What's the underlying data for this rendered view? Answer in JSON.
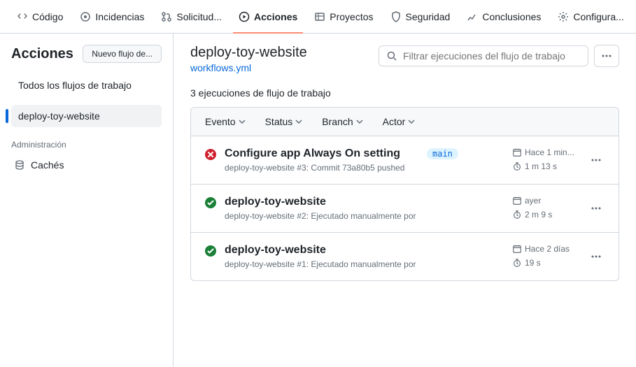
{
  "nav": {
    "code": "Código",
    "issues": "Incidencias",
    "pulls": "Solicitud...",
    "actions": "Acciones",
    "projects": "Proyectos",
    "security": "Seguridad",
    "insights": "Conclusiones",
    "settings": "Configura..."
  },
  "sidebar": {
    "title": "Acciones",
    "new_workflow_btn": "Nuevo flujo de...",
    "all_workflows": "Todos los flujos de trabajo",
    "selected_wf": "deploy-toy-website",
    "admin_label": "Administración",
    "caches": "Cachés"
  },
  "page": {
    "title": "deploy-toy-website",
    "file": "workflows.yml",
    "search_placeholder": "Filtrar ejecuciones del flujo de trabajo",
    "runs_count": "3 ejecuciones de flujo de trabajo"
  },
  "filters": {
    "event": "Evento",
    "status": "Status",
    "branch": "Branch",
    "actor": "Actor"
  },
  "runs": [
    {
      "status": "fail",
      "title": "Configure app Always On setting",
      "sub": "deploy-toy-website #3: Commit 73a80b5 pushed",
      "branch": "main",
      "time": "Hace 1 min...",
      "duration": "1 m  13 s"
    },
    {
      "status": "success",
      "title": "deploy-toy-website",
      "sub": "deploy-toy-website #2: Ejecutado manualmente por",
      "branch": "",
      "time": "ayer",
      "duration": "2 m  9 s"
    },
    {
      "status": "success",
      "title": "deploy-toy-website",
      "sub": "deploy-toy-website #1: Ejecutado manualmente por",
      "branch": "",
      "time": "Hace 2 días",
      "duration": "19 s"
    }
  ]
}
